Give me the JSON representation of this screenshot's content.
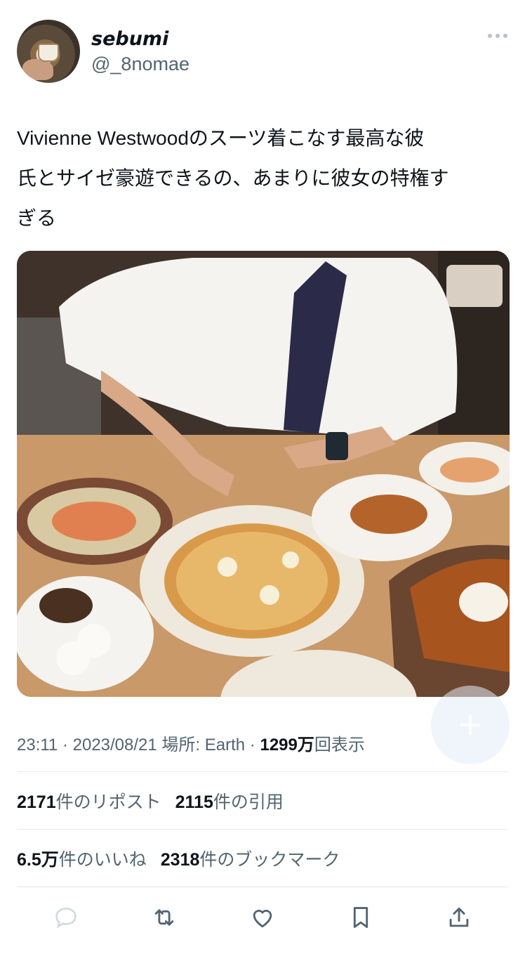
{
  "author": {
    "display_name": "sebumi",
    "handle": "@_8nomae"
  },
  "tweet": {
    "text_line1": "Vivienne Westwoodのスーツ着こなす最高な彼",
    "text_line2": "氏とサイゼ豪遊できるの、あまりに彼女の特権す",
    "text_line3": "ぎる"
  },
  "meta": {
    "time": "23:11",
    "date": "2023/08/21",
    "location_label": "場所: Earth",
    "views_count": "1299万",
    "views_label": "回表示"
  },
  "stats": {
    "reposts_count": "2171",
    "reposts_label": "件のリポスト",
    "quotes_count": "2115",
    "quotes_label": "件の引用",
    "likes_count": "6.5万",
    "likes_label": "件のいいね",
    "bookmarks_count": "2318",
    "bookmarks_label": "件のブックマーク"
  },
  "icons": {
    "more": "more-horizontal-icon",
    "reply": "reply-icon",
    "repost": "repost-icon",
    "like": "heart-icon",
    "bookmark": "bookmark-icon",
    "share": "share-icon",
    "compose": "plus-icon"
  },
  "colors": {
    "text_primary": "#0f1419",
    "text_secondary": "#536471",
    "divider": "#e6e9eb",
    "icon": "#536471"
  }
}
